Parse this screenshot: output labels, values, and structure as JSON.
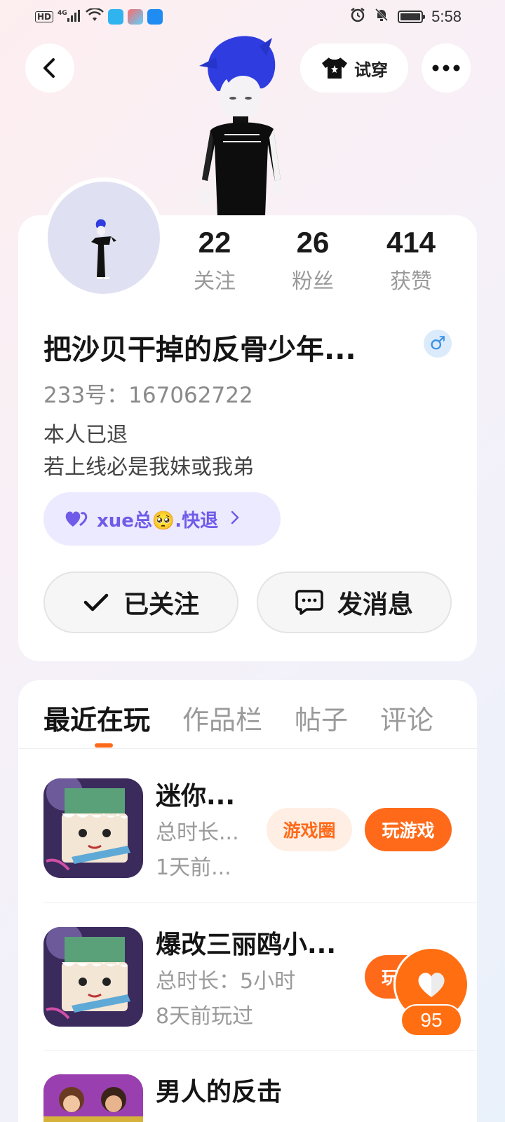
{
  "status_bar": {
    "network": "4G",
    "hd_badge": "HD",
    "time": "5:58"
  },
  "header": {
    "tryon_label": "试穿"
  },
  "profile": {
    "stats": [
      {
        "value": "22",
        "label": "关注"
      },
      {
        "value": "26",
        "label": "粉丝"
      },
      {
        "value": "414",
        "label": "获赞"
      }
    ],
    "nickname": "把沙贝干掉的反骨少年...",
    "gender_symbol": "♂",
    "uid": "233号：167062722",
    "bio_line1": "本人已退",
    "bio_line2": "若上线必是我妹或我弟",
    "tag_text": "xue总🥺.快退",
    "follow_label": "已关注",
    "message_label": "发消息"
  },
  "tabs": [
    "最近在玩",
    "作品栏",
    "帖子",
    "评论"
  ],
  "games": [
    {
      "name": "迷你...",
      "duration": "总时长...",
      "last_played": "1天前...",
      "circle_label": "游戏圈",
      "play_label": "玩游戏"
    },
    {
      "name": "爆改三丽鸥小...",
      "duration": "总时长：5小时",
      "last_played": "8天前玩过",
      "play_label": "玩"
    },
    {
      "name": "男人的反击"
    }
  ],
  "like": {
    "count": "95"
  },
  "colors": {
    "accent": "#ff6a1a",
    "tag_bg": "#ebeaff",
    "tag_text": "#6f5be8",
    "gender": "#3a8fe8"
  }
}
